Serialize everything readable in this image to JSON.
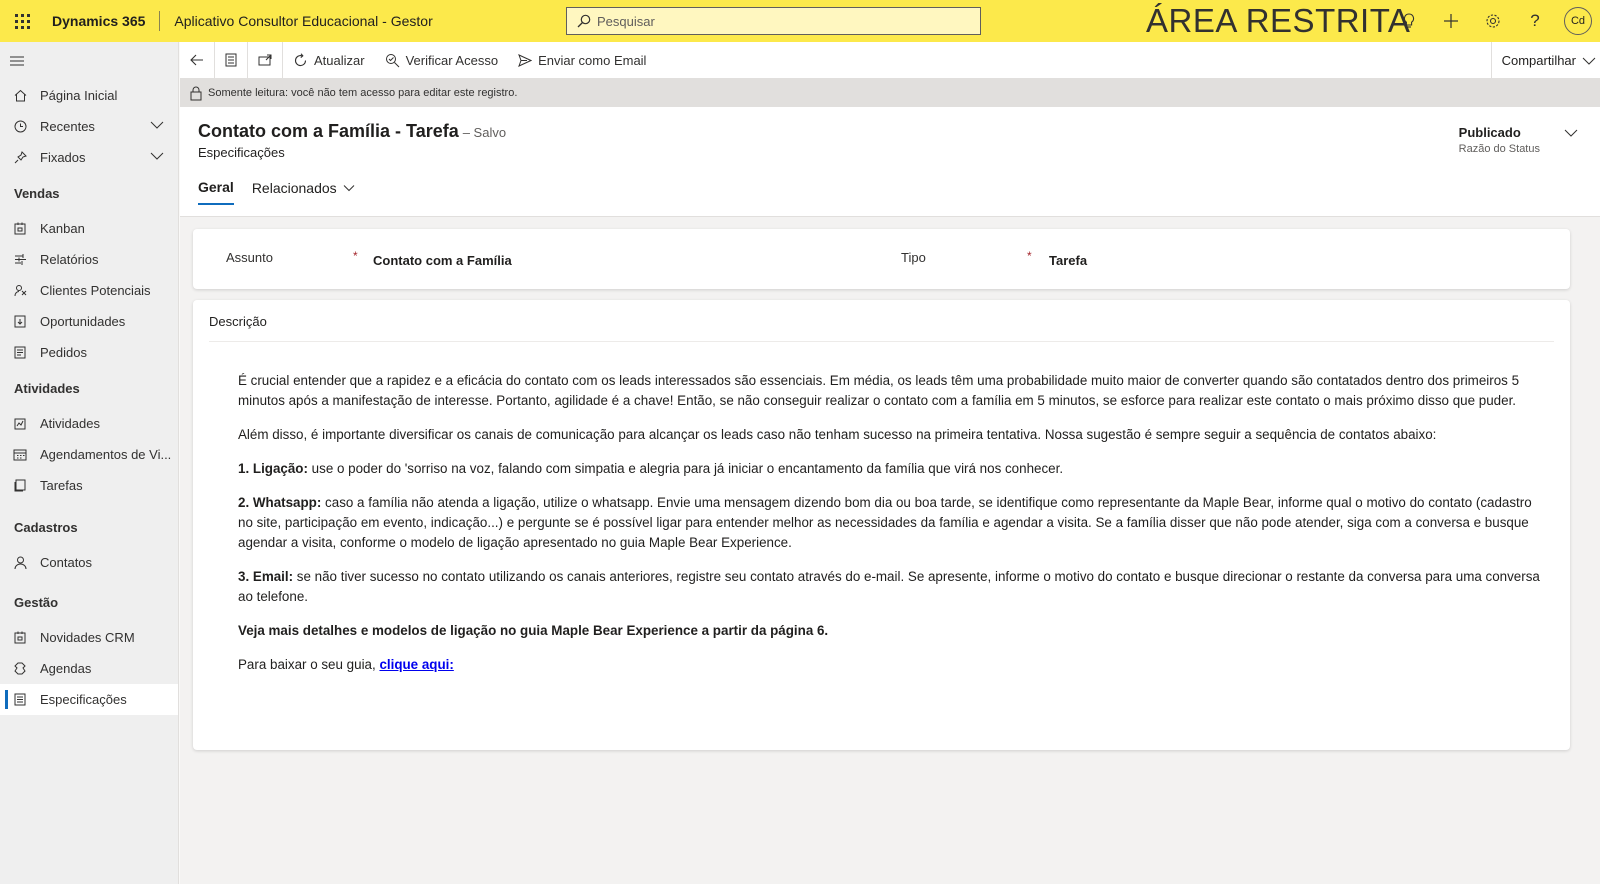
{
  "topbar": {
    "brand": "Dynamics 365",
    "app_name": "Aplicativo Consultor Educacional - Gestor",
    "search_placeholder": "Pesquisar",
    "restricted_label": "ÁREA RESTRITA",
    "avatar_initials": "Cd",
    "icons": [
      "lightbulb-icon",
      "plus-icon",
      "gear-icon",
      "help-icon"
    ]
  },
  "sidebar": {
    "items_top": [
      {
        "label": "Página Inicial",
        "icon": "home-icon"
      },
      {
        "label": "Recentes",
        "icon": "clock-icon"
      },
      {
        "label": "Fixados",
        "icon": "pin-icon"
      }
    ],
    "sections": [
      {
        "title": "Vendas",
        "items": [
          {
            "label": "Kanban",
            "icon": "board-icon"
          },
          {
            "label": "Relatórios",
            "icon": "report-icon"
          },
          {
            "label": "Clientes Potenciais",
            "icon": "leads-icon"
          },
          {
            "label": "Oportunidades",
            "icon": "opportunity-icon"
          },
          {
            "label": "Pedidos",
            "icon": "order-icon"
          }
        ]
      },
      {
        "title": "Atividades",
        "items": [
          {
            "label": "Atividades",
            "icon": "activity-icon"
          },
          {
            "label": "Agendamentos de Vi...",
            "icon": "calendar-icon"
          },
          {
            "label": "Tarefas",
            "icon": "task-icon"
          }
        ]
      },
      {
        "title": "Cadastros",
        "items": [
          {
            "label": "Contatos",
            "icon": "person-icon"
          }
        ]
      },
      {
        "title": "Gestão",
        "items": [
          {
            "label": "Novidades CRM",
            "icon": "news-icon"
          },
          {
            "label": "Agendas",
            "icon": "agenda-icon"
          },
          {
            "label": "Especificações",
            "icon": "spec-icon"
          }
        ]
      }
    ]
  },
  "commandbar": {
    "refresh": "Atualizar",
    "check_access": "Verificar Acesso",
    "send_email": "Enviar como Email",
    "share": "Compartilhar"
  },
  "readonly_notice": "Somente leitura: você não tem acesso para editar este registro.",
  "record": {
    "title": "Contato com a Família - Tarefa",
    "saved": "– Salvo",
    "entity": "Especificações",
    "status_value": "Publicado",
    "status_label": "Razão do Status",
    "tabs": [
      "Geral",
      "Relacionados"
    ]
  },
  "fields": {
    "subject_label": "Assunto",
    "subject_value": "Contato com a Família",
    "type_label": "Tipo",
    "type_value": "Tarefa",
    "required_mark": "*",
    "description_label": "Descrição"
  },
  "description": {
    "p1": "É crucial entender que a rapidez e a eficácia do contato com os leads interessados são essenciais. Em média, os leads têm uma probabilidade muito maior de converter quando são contatados dentro dos primeiros 5 minutos após a manifestação de interesse. Portanto, agilidade é a chave! Então, se não conseguir realizar o contato com a família em 5 minutos, se esforce para realizar este contato o mais próximo disso que puder.",
    "p2": "Além disso, é importante diversificar os canais de comunicação para alcançar os leads caso não tenham sucesso na primeira tentativa. Nossa sugestão é sempre seguir a sequência de contatos abaixo:",
    "s1_title": "1. Ligação:",
    "s1_text": " use o poder do 'sorriso na voz, falando com simpatia e alegria para já iniciar o encantamento da família que virá nos conhecer.",
    "s2_title": "2. Whatsapp:",
    "s2_text": " caso a família não atenda a ligação, utilize o whatsapp. Envie uma mensagem dizendo bom dia ou boa tarde, se identifique como representante da Maple Bear, informe qual o motivo do contato (cadastro no site, participação em evento, indicação...) e pergunte se é possível ligar para entender melhor as necessidades da família e agendar a visita. Se a família disser que não pode atender, siga com a conversa e busque agendar a visita, conforme o modelo de ligação apresentado no guia Maple Bear Experience.",
    "s3_title": "3. Email:",
    "s3_text": " se não tiver sucesso no contato utilizando os canais anteriores, registre seu contato através do e-mail. Se apresente, informe o motivo do contato e busque direcionar o restante da conversa para uma conversa ao telefone.",
    "highlight": "Veja mais detalhes e modelos de ligação no guia Maple Bear Experience a partir da página 6.",
    "download_text": "Para baixar o seu guia, ",
    "download_link": "clique aqui:"
  }
}
